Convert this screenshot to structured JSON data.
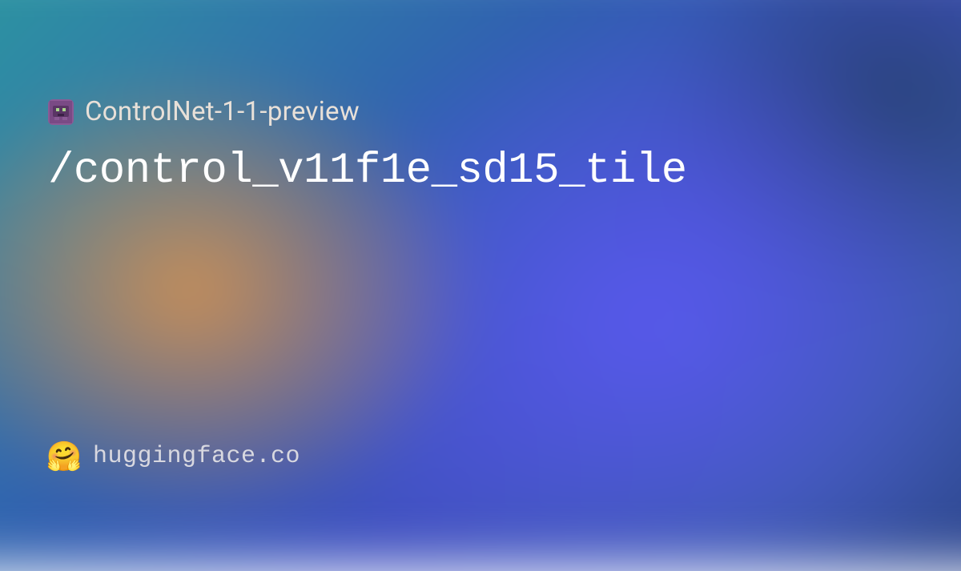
{
  "org": {
    "name": "ControlNet-1-1-preview",
    "icon_name": "pixel-avatar"
  },
  "model": {
    "path": "/control_v11f1e_sd15_tile"
  },
  "footer": {
    "site": "huggingface.co",
    "icon_name": "hugging-face"
  }
}
